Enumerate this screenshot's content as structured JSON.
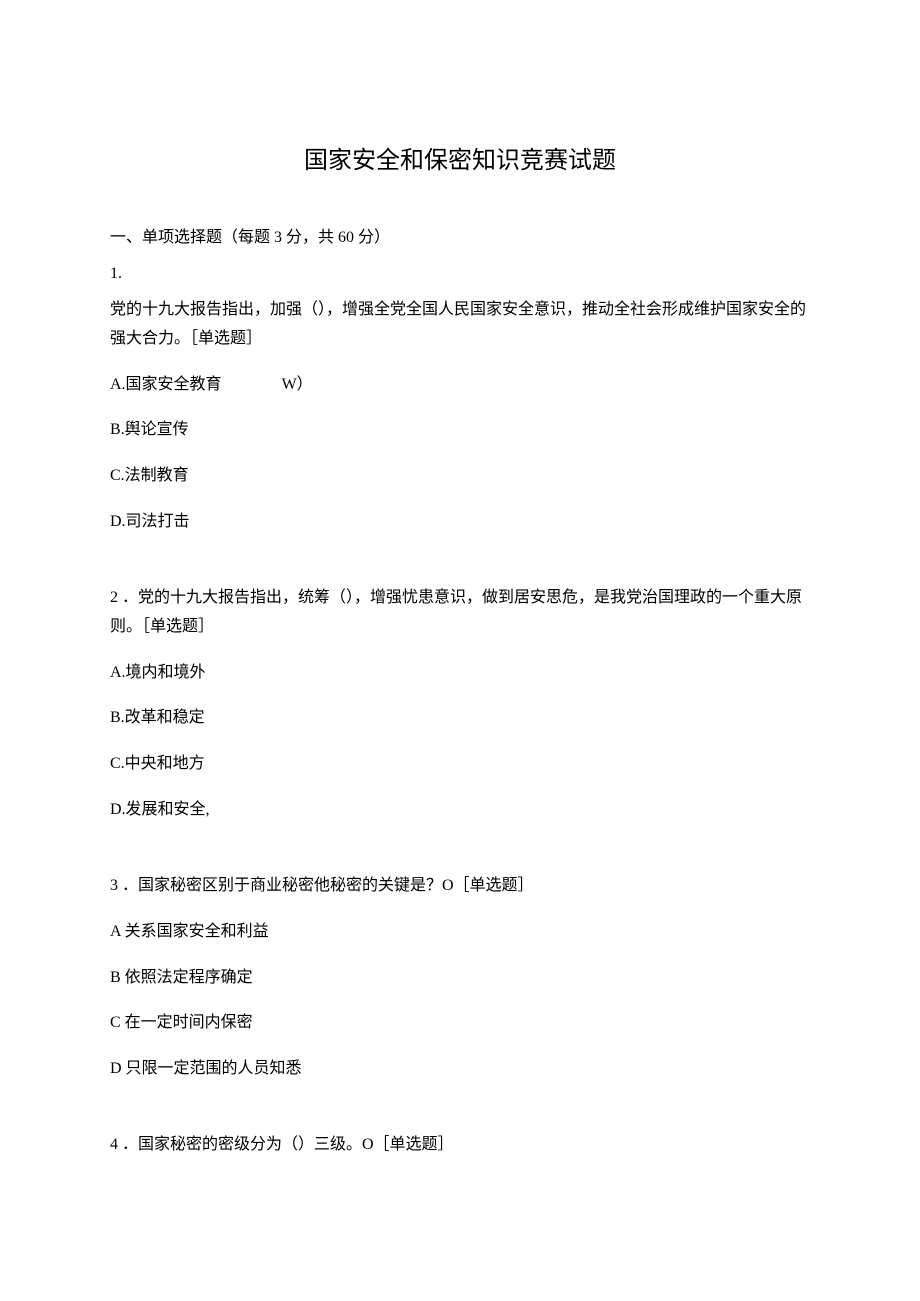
{
  "title": "国家安全和保密知识竞赛试题",
  "sectionHeader": "一、单项选择题（每题 3 分，共 60 分）",
  "q1": {
    "number": "1.",
    "text": "党的十九大报告指出，加强（），增强全党全国人民国家安全意识，推动全社会形成维护国家安全的强大合力。［单选题］",
    "optA_label": "A.国家安全教育",
    "optA_mark": "W）",
    "optB": "B.舆论宣传",
    "optC": "C.法制教育",
    "optD": "D.司法打击"
  },
  "q2": {
    "numberAndText": "2 ．党的十九大报告指出，统筹（），增强忧患意识，做到居安思危，是我党治国理政的一个重大原则。［单选题］",
    "optA": "A.境内和境外",
    "optB": "B.改革和稳定",
    "optC": "C.中央和地方",
    "optD": "D.发展和安全,"
  },
  "q3": {
    "numberAndText": "3 ．国家秘密区别于商业秘密他秘密的关键是？O［单选题］",
    "optA": "A 关系国家安全和利益",
    "optB": "B 依照法定程序确定",
    "optC": "C 在一定时间内保密",
    "optD": "D 只限一定范围的人员知悉"
  },
  "q4": {
    "numberAndText": "4 ．国家秘密的密级分为（）三级。O［单选题］"
  }
}
